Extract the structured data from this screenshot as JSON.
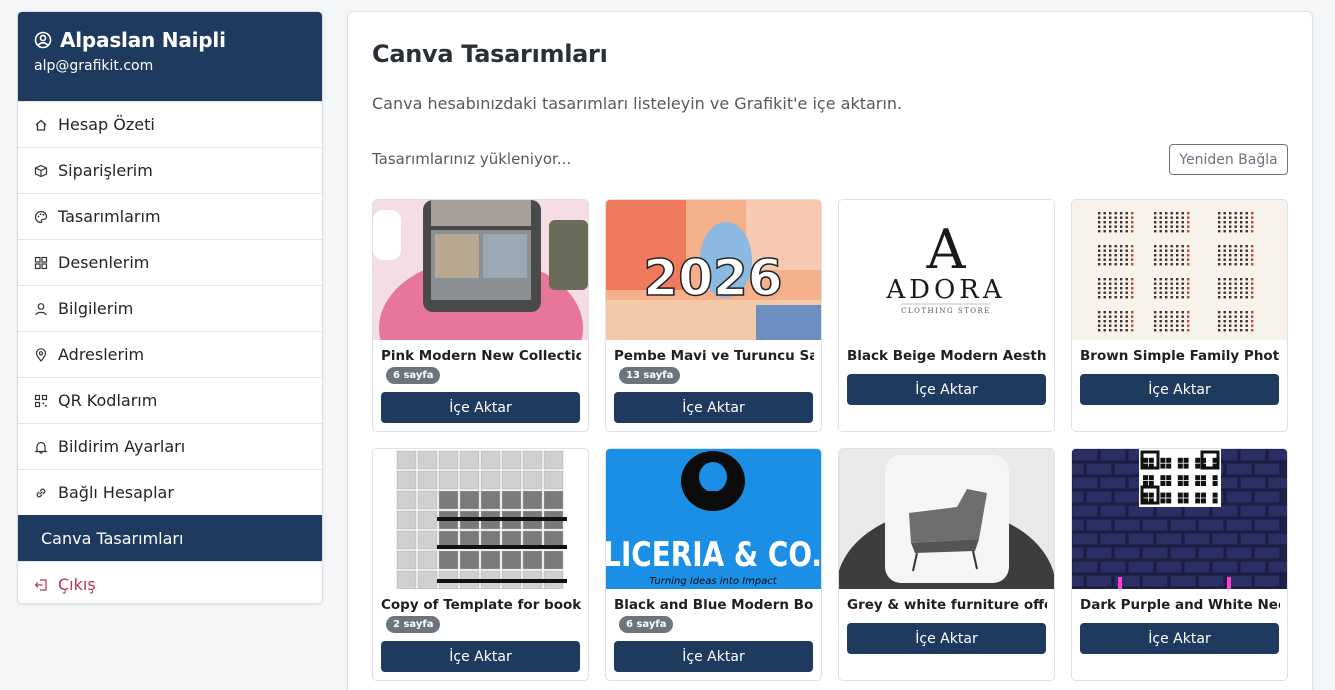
{
  "sidebar": {
    "user_name": "Alpaslan Naipli",
    "user_email": "alp@grafikit.com",
    "items": [
      {
        "label": "Hesap Özeti",
        "icon": "home-icon"
      },
      {
        "label": "Siparişlerim",
        "icon": "box-icon"
      },
      {
        "label": "Tasarımlarım",
        "icon": "palette-icon"
      },
      {
        "label": "Desenlerim",
        "icon": "grid-icon"
      },
      {
        "label": "Bilgilerim",
        "icon": "person-icon"
      },
      {
        "label": "Adreslerim",
        "icon": "map-pin-icon"
      },
      {
        "label": "QR Kodlarım",
        "icon": "qr-code-icon"
      },
      {
        "label": "Bildirim Ayarları",
        "icon": "bell-icon"
      },
      {
        "label": "Bağlı Hesaplar",
        "icon": "link-icon"
      },
      {
        "label": "Canva Tasarımları",
        "icon": "",
        "active": true
      },
      {
        "label": "Çıkış",
        "icon": "logout-icon"
      }
    ]
  },
  "main": {
    "title": "Canva Tasarımları",
    "subtitle": "Canva hesabınızdaki tasarımları listeleyin ve Grafikit'e içe aktarın.",
    "loading_text": "Tasarımlarınız yükleniyor...",
    "reconnect_label": "Yeniden Bağla",
    "import_label": "İçe Aktar",
    "designs": [
      {
        "title": "Pink Modern New Collection",
        "pages": "6 sayfa"
      },
      {
        "title": "Pembe Mavi ve Turuncu San",
        "pages": "13 sayfa",
        "thumb_text": "2026"
      },
      {
        "title": "Black Beige Modern Aesthet",
        "pages": "",
        "thumb_text": "A",
        "thumb_text2": "ADORA",
        "thumb_text3": "CLOTHING STORE"
      },
      {
        "title": "Brown Simple Family Photo-",
        "pages": ""
      },
      {
        "title": "Copy of Template for books",
        "pages": "2 sayfa"
      },
      {
        "title": "Black and Blue Modern Bold",
        "pages": "6 sayfa",
        "thumb_text": "LICERIA & CO.",
        "thumb_text2": "Turning Ideas into Impact"
      },
      {
        "title": "Grey & white furniture offer i",
        "pages": ""
      },
      {
        "title": "Dark Purple and White Neon",
        "pages": ""
      }
    ]
  },
  "colors": {
    "navy": "#1e3a5f",
    "badge_grey": "#6c757d",
    "logout_red": "#c0334e"
  }
}
